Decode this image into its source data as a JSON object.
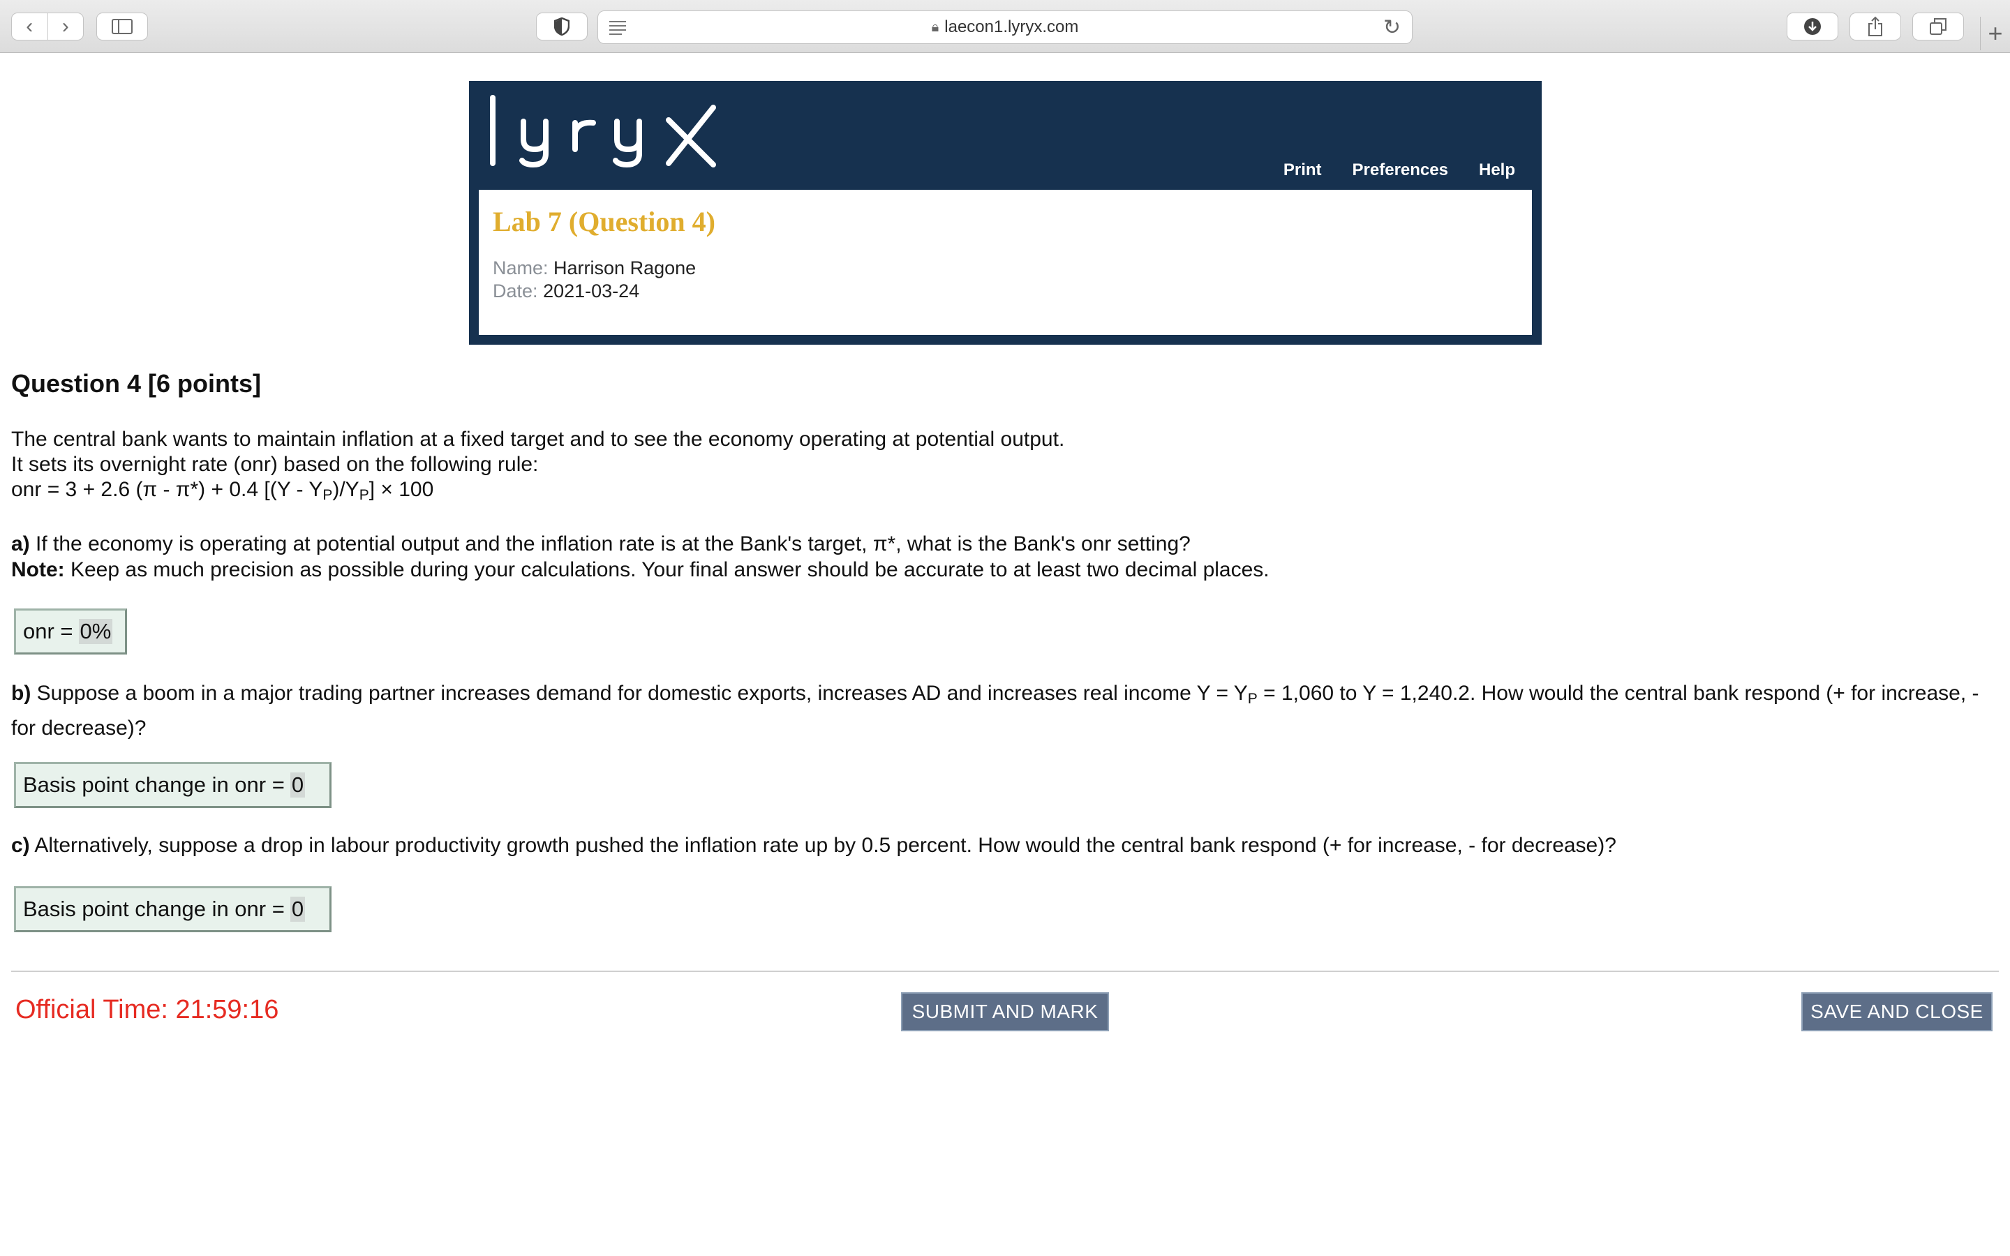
{
  "browser": {
    "url": "laecon1.lyryx.com"
  },
  "header": {
    "logo_text": "lyryx",
    "nav": [
      "Print",
      "Preferences",
      "Help"
    ],
    "lab_title": "Lab 7 (Question 4)",
    "name_label": "Name:",
    "name_value": "Harrison Ragone",
    "date_label": "Date:",
    "date_value": "2021-03-24"
  },
  "question": {
    "title": "Question 4 [6 points]",
    "intro_line1": "The central bank wants to maintain inflation at a fixed target and to see the economy operating at potential output.",
    "intro_line2": "It sets its overnight rate (onr) based on the following rule:",
    "rule_a": "onr = 3 + 2.6 (π - π*) + 0.4 [(Y - Y",
    "rule_sub1": "P",
    "rule_b": ")/Y",
    "rule_sub2": "P",
    "rule_c": "] × 100",
    "part_a": {
      "label": "a)",
      "text": " If the economy is operating at potential output and the inflation rate is at the Bank's target, π*, what is the Bank's onr setting?",
      "note_label": "Note:",
      "note_text": " Keep as much precision as possible during your calculations. Your final answer should be accurate to at least two decimal places.",
      "answer_prefix": "onr =",
      "answer_value": "0%"
    },
    "part_b": {
      "label": "b)",
      "text_1": " Suppose a boom in a major trading partner increases demand for domestic exports, increases AD and increases real income Y = Y",
      "sub": "P",
      "text_2": " = 1,060 to Y = 1,240.2. How would the central bank respond (+ for increase, - for decrease)?",
      "answer_prefix": "Basis point change in onr =",
      "answer_value": "0"
    },
    "part_c": {
      "label": "c)",
      "text": " Alternatively, suppose a drop in labour productivity growth pushed the inflation rate up by 0.5 percent. How would the central bank respond (+ for increase, - for decrease)?",
      "answer_prefix": "Basis point change in onr =",
      "answer_value": "0"
    }
  },
  "footer": {
    "official_time": "Official Time: 21:59:16",
    "submit_label": "SUBMIT AND MARK",
    "save_label": "SAVE AND CLOSE"
  },
  "colors": {
    "header_bg": "#16314f",
    "title_gold": "#e0ad2e",
    "time_red": "#e62b22",
    "button_bg": "#5d6e88",
    "answer_bg": "#e8f2ec"
  }
}
